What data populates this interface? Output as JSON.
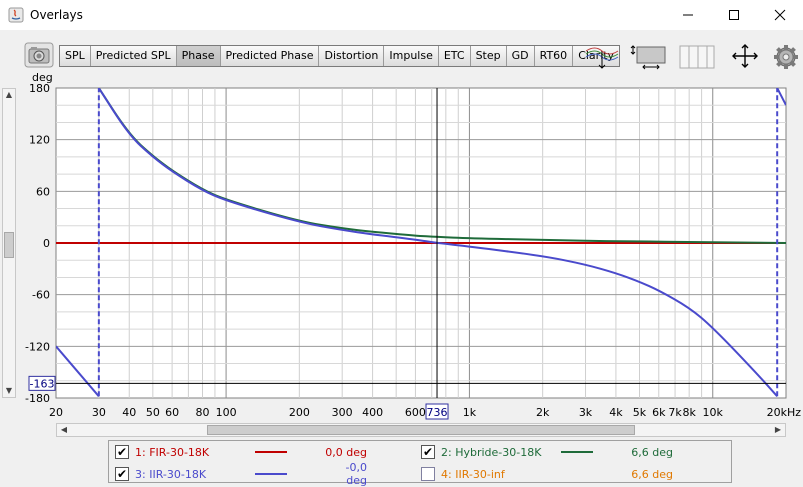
{
  "window": {
    "title": "Overlays"
  },
  "toolbar": {
    "tabs": [
      {
        "label": "SPL",
        "active": false
      },
      {
        "label": "Predicted SPL",
        "active": false
      },
      {
        "label": "Phase",
        "active": true
      },
      {
        "label": "Predicted Phase",
        "active": false
      },
      {
        "label": "Distortion",
        "active": false
      },
      {
        "label": "Impulse",
        "active": false
      },
      {
        "label": "ETC",
        "active": false
      },
      {
        "label": "Step",
        "active": false
      },
      {
        "label": "GD",
        "active": false
      },
      {
        "label": "RT60",
        "active": false
      },
      {
        "label": "Clarity",
        "active": false
      }
    ]
  },
  "chart_data": {
    "type": "line",
    "ylabel": "deg",
    "x_scale": "log",
    "xlim": [
      20,
      20000
    ],
    "ylim": [
      -180,
      180
    ],
    "y_ticks": [
      180,
      120,
      60,
      0,
      -60,
      -120,
      -180
    ],
    "x_tick_labels": [
      {
        "f": 20,
        "label": "20"
      },
      {
        "f": 30,
        "label": "30"
      },
      {
        "f": 40,
        "label": "40"
      },
      {
        "f": 50,
        "label": "50"
      },
      {
        "f": 60,
        "label": "60"
      },
      {
        "f": 80,
        "label": "80"
      },
      {
        "f": 100,
        "label": "100"
      },
      {
        "f": 200,
        "label": "200"
      },
      {
        "f": 300,
        "label": "300"
      },
      {
        "f": 400,
        "label": "400"
      },
      {
        "f": 600,
        "label": "600"
      },
      {
        "f": 1000,
        "label": "1k"
      },
      {
        "f": 2000,
        "label": "2k"
      },
      {
        "f": 3000,
        "label": "3k"
      },
      {
        "f": 4000,
        "label": "4k"
      },
      {
        "f": 5000,
        "label": "5k"
      },
      {
        "f": 6000,
        "label": "6k"
      },
      {
        "f": 7000,
        "label": "7k"
      },
      {
        "f": 8000,
        "label": "8k"
      },
      {
        "f": 10000,
        "label": "10k"
      },
      {
        "f": 20000,
        "label": "20kHz"
      }
    ],
    "cursor": {
      "x": 736,
      "y": -163,
      "x_label": "736",
      "y_label": "-163"
    },
    "series": [
      {
        "name": "FIR-30-18K",
        "color": "#c00000",
        "x": [
          20,
          20000
        ],
        "y": [
          0,
          0
        ]
      },
      {
        "name": "Hybride-30-18K",
        "color": "#1f6b3a",
        "x": [
          30,
          40,
          50,
          60,
          80,
          100,
          200,
          300,
          400,
          600,
          736,
          1000,
          2000,
          4000,
          10000,
          20000
        ],
        "y": [
          180,
          126,
          101,
          84,
          62,
          50,
          25,
          17,
          13,
          8.5,
          7,
          5.5,
          3.5,
          2,
          1,
          0
        ]
      },
      {
        "name": "IIR-30-18K",
        "color": "#4a4acc",
        "x": [
          20,
          30,
          30,
          40,
          50,
          60,
          80,
          100,
          200,
          300,
          400,
          600,
          736,
          1000,
          2000,
          3000,
          4000,
          5000,
          6000,
          8000,
          10000,
          15000,
          18400,
          18400,
          20000
        ],
        "y": [
          -120,
          -178,
          180,
          125,
          100,
          83,
          61,
          49,
          24,
          15,
          10,
          4,
          0,
          -4,
          -15,
          -25,
          -35,
          -45,
          -55,
          -75,
          -98,
          -150,
          -178,
          180,
          160
        ],
        "vertical_at": [
          30,
          18400
        ]
      }
    ],
    "legend": [
      {
        "index": "1",
        "name": "FIR-30-18K",
        "value": "0,0 deg",
        "checked": true,
        "color": "#c00000",
        "line_color": "#c00000"
      },
      {
        "index": "2",
        "name": "Hybride-30-18K",
        "value": "6,6 deg",
        "checked": true,
        "color": "#1f6b3a",
        "line_color": "#1f6b3a"
      },
      {
        "index": "3",
        "name": "IIR-30-18K",
        "value": "-0,0 deg",
        "checked": true,
        "color": "#4a4acc",
        "line_color": "#4a4acc"
      },
      {
        "index": "4",
        "name": "IIR-30-inf",
        "value": "6,6 deg",
        "checked": false,
        "color": "#e07800",
        "line_color": ""
      }
    ]
  }
}
